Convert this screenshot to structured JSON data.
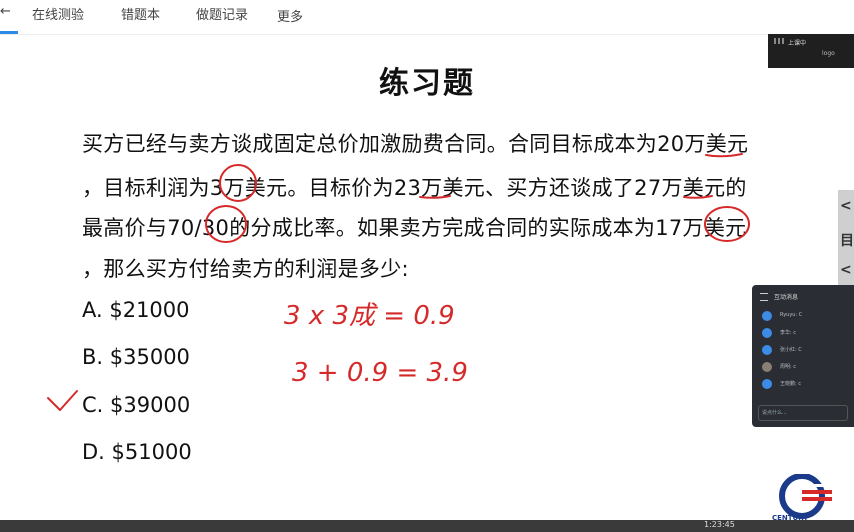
{
  "nav": {
    "edge": "←",
    "items": [
      "在线测验",
      "错题本",
      "做题记录",
      "更多"
    ]
  },
  "slide": {
    "title": "练习题",
    "question_lines": [
      "买方已经与卖方谈成固定总价加激励费合同。合同目标成本为20万美元",
      "，目标利润为3万美元。目标价为23万美元、买方还谈成了27万美元的",
      "最高价与70/30的分成比率。如果卖方完成合同的实际成本为17万美元",
      "，那么买方付给卖方的利润是多少:"
    ],
    "options": [
      "A. $21000",
      "B. $35000",
      "C. $39000",
      "D. $51000"
    ],
    "selected_option": "C"
  },
  "annotations": {
    "line1": "3 x 3成 = 0.9",
    "line2": "3 + 0.9 = 3.9"
  },
  "video_thumb": {
    "status": "上课中",
    "logo": "logo"
  },
  "side_panel": {
    "chars": [
      "<",
      "目",
      "<"
    ]
  },
  "chat": {
    "title": "互动消息",
    "messages": [
      "Ryuyu: C",
      "李华: c",
      "张小红: C",
      "周明: c",
      "王晓鹏: c"
    ],
    "input_placeholder": "说点什么..."
  },
  "player": {
    "time": "1:23:45"
  },
  "brand": {
    "name": "CENTURY",
    "accent": "#2b8ae8",
    "ink": "#d62a2a"
  }
}
